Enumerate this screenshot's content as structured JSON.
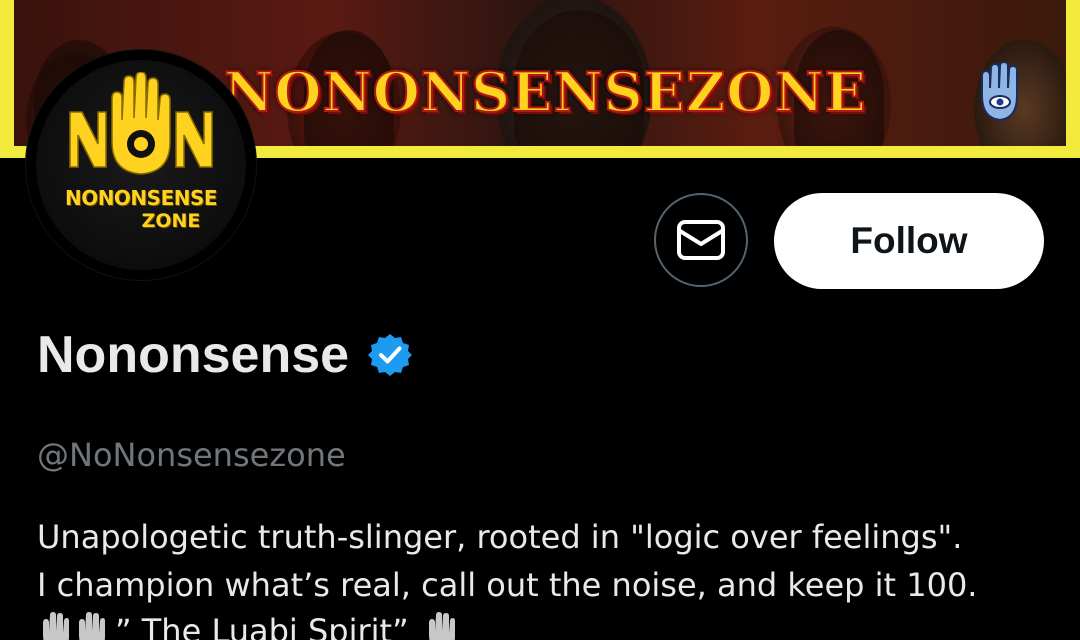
{
  "banner": {
    "title": "NONONSENSEZONE",
    "icon": "hamsa-eye-icon",
    "border_color": "#f2ea3c"
  },
  "avatar": {
    "logo_text_line1": "NONONSENSE",
    "logo_text_line2": "ZONE",
    "icon": "hand-eye-logo-icon",
    "accent": "#ffd21f"
  },
  "actions": {
    "message_icon": "envelope-icon",
    "follow_label": "Follow"
  },
  "profile": {
    "display_name": "Nononsense",
    "verified_icon": "verified-badge-icon",
    "verified_color": "#1d9bf0",
    "handle": "@NoNonsensezone",
    "bio_line1": "Unapologetic truth-slinger, rooted in \"logic over feelings\".",
    "bio_line2": "I champion what’s real, call out the noise, and keep it 100.",
    "bio_line3": "” The  Luabi  Spirit”",
    "bio_emoji": "hamsa-icon"
  }
}
